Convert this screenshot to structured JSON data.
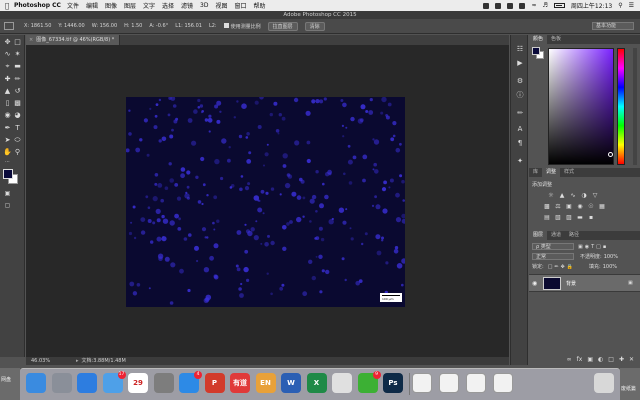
{
  "menubar": {
    "app_name": "Photoshop CC",
    "menu_items": [
      "文件",
      "编辑",
      "图像",
      "图层",
      "文字",
      "选择",
      "滤镜",
      "3D",
      "视图",
      "窗口",
      "帮助"
    ],
    "clock": "周四上午12:13"
  },
  "window": {
    "title": "Adobe Photoshop CC 2015"
  },
  "options_bar": {
    "x": "X: 1861.50",
    "y": "Y: 1446.00",
    "w": "W: 156.00",
    "h": "H: 1.50",
    "angle": "A: -0.6°",
    "l1": "L1: 156.01",
    "l2": "L2:",
    "use_scale_label": "使用测量比例",
    "straighten_button": "拉直图层",
    "clear_button": "清除",
    "workspace": "基本功能"
  },
  "document": {
    "tab_label": "图像_67334.tif @ 46%(RGB/8) *",
    "scale_label": "100 μm"
  },
  "status": {
    "zoom": "46.03%",
    "doc_size": "文档:3.88M/1.48M"
  },
  "panels": {
    "color_tabs": [
      "颜色",
      "色板"
    ],
    "adjust_tabs": [
      "库",
      "调整",
      "样式"
    ],
    "adjust_title": "添加调整",
    "layer_tabs": [
      "图层",
      "通道",
      "路径"
    ],
    "kind_filter": "ρ 类型",
    "blend_mode": "正常",
    "opacity_label": "不透明度:",
    "opacity_value": "100%",
    "lock_label": "锁定:",
    "fill_label": "填充:",
    "fill_value": "100%",
    "layer_name": "背景"
  },
  "dock": {
    "items": [
      {
        "name": "finder",
        "label": "",
        "color": "#3a8be0"
      },
      {
        "name": "launchpad",
        "label": "",
        "color": "#8a8f99"
      },
      {
        "name": "safari",
        "label": "",
        "color": "#2d7de0"
      },
      {
        "name": "mail",
        "label": "",
        "color": "#4ea0e8",
        "badge": "17"
      },
      {
        "name": "calendar",
        "label": "29",
        "color": "#ffffff"
      },
      {
        "name": "system-preferences",
        "label": "",
        "color": "#7d7d7d"
      },
      {
        "name": "app-store",
        "label": "",
        "color": "#2d8ae6",
        "badge": "4"
      },
      {
        "name": "wps",
        "label": "P",
        "color": "#d23b2b"
      },
      {
        "name": "youdao",
        "label": "有道",
        "color": "#e03a3a"
      },
      {
        "name": "evernote",
        "label": "EN",
        "color": "#e8a13a"
      },
      {
        "name": "word",
        "label": "W",
        "color": "#2b5fb4"
      },
      {
        "name": "excel",
        "label": "X",
        "color": "#1f8a47"
      },
      {
        "name": "chrome",
        "label": "",
        "color": "#e0e0e0"
      },
      {
        "name": "wechat",
        "label": "",
        "color": "#3cb034",
        "badge": "9"
      },
      {
        "name": "photoshop",
        "label": "Ps",
        "color": "#0e2a47"
      }
    ],
    "left_peek": "网盘",
    "right_peek": "废纸篓"
  },
  "colors": {
    "image_bg": "#0a0930",
    "cell_color": "#3a2fd8",
    "accent": "#7a22ff"
  }
}
